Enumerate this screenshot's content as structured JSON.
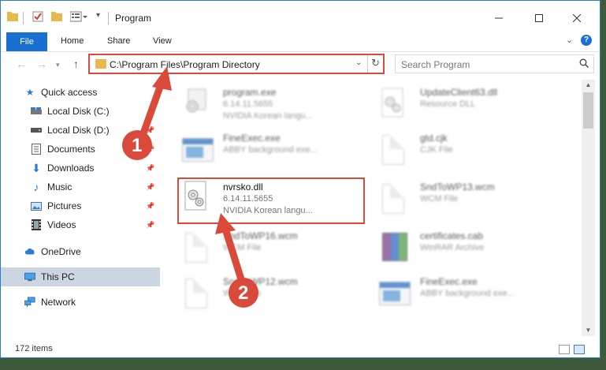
{
  "window": {
    "title": "Program"
  },
  "ribbon": {
    "file": "File",
    "home": "Home",
    "share": "Share",
    "view": "View",
    "help": "?"
  },
  "address": {
    "path": "C:\\Program Files\\Program Directory",
    "search_placeholder": "Search Program"
  },
  "sidebar": {
    "items": [
      {
        "label": "Quick access",
        "icon": "star-icon",
        "pinned": false
      },
      {
        "label": "Local Disk (C:)",
        "icon": "drive-icon",
        "pinned": false
      },
      {
        "label": "Local Disk (D:)",
        "icon": "drive-icon",
        "pinned": true
      },
      {
        "label": "Documents",
        "icon": "documents-icon",
        "pinned": true
      },
      {
        "label": "Downloads",
        "icon": "downloads-icon",
        "pinned": true
      },
      {
        "label": "Music",
        "icon": "music-icon",
        "pinned": true
      },
      {
        "label": "Pictures",
        "icon": "pictures-icon",
        "pinned": true
      },
      {
        "label": "Videos",
        "icon": "videos-icon",
        "pinned": true
      },
      {
        "label": "OneDrive",
        "icon": "onedrive-icon",
        "pinned": false
      },
      {
        "label": "This PC",
        "icon": "this-pc-icon",
        "pinned": false,
        "selected": true
      },
      {
        "label": "Network",
        "icon": "network-icon",
        "pinned": false
      }
    ]
  },
  "files": [
    {
      "name": "program.exe",
      "line1": "6.14.11.5655",
      "line2": "NVIDIA Korean langu...",
      "icon": "exe-gear-icon"
    },
    {
      "name": "UpdateClient63.dll",
      "line1": "Resource DLL",
      "line2": "",
      "icon": "dll-icon"
    },
    {
      "name": "FineExec.exe",
      "line1": "ABBY background exe...",
      "line2": "",
      "icon": "app-window-icon"
    },
    {
      "name": "gtd.cjk",
      "line1": "CJK File",
      "line2": "",
      "icon": "blank-file-icon"
    },
    {
      "name": "nvrsko.dll",
      "line1": "6.14.11.5655",
      "line2": "NVIDIA Korean langu...",
      "icon": "dll-gear-icon"
    },
    {
      "name": "SndToWP13.wcm",
      "line1": "WCM File",
      "line2": "",
      "icon": "blank-file-icon"
    },
    {
      "name": "SndToWP16.wcm",
      "line1": "WCM File",
      "line2": "",
      "icon": "blank-file-icon"
    },
    {
      "name": "certificates.cab",
      "line1": "WinRAR Archive",
      "line2": "",
      "icon": "winrar-icon"
    },
    {
      "name": "SndToWP12.wcm",
      "line1": "WCM File",
      "line2": "",
      "icon": "blank-file-icon"
    },
    {
      "name": "FineExec.exe",
      "line1": "ABBY background exe...",
      "line2": "",
      "icon": "app-window-icon"
    }
  ],
  "status": {
    "count": "172 items"
  },
  "annotations": {
    "step1": "1",
    "step2": "2",
    "color": "#d94a3a"
  }
}
